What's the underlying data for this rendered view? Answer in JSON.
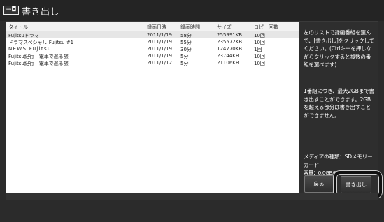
{
  "app": {
    "icon_glyph": "→◘",
    "title": "書き出し"
  },
  "list": {
    "columns": [
      "タイトル",
      "録画日時",
      "録画時間",
      "サイズ",
      "コピー回数"
    ],
    "rows": [
      [
        "Fujitsuドラマ",
        "2011/1/19",
        "58分",
        "255991KB",
        "10回"
      ],
      [
        "ドラマスペシャル Fujitsu #1",
        "2011/1/19",
        "55分",
        "235572KB",
        "10回"
      ],
      [
        "NEWS Fujitsu",
        "2011/1/19",
        "30分",
        "124770KB",
        "1回"
      ],
      [
        "Fujitsu紀行　電車で巡る旅",
        "2011/1/19",
        "5分",
        "23744KB",
        "10回"
      ],
      [
        "Fujitsu紀行　電車で巡る旅",
        "2011/1/12",
        "5分",
        "21106KB",
        "10回"
      ]
    ]
  },
  "sidebar": {
    "help1": "左のリストで録画番組を選んで、[書き出し]をクリックしてください。(Ctrlキーを押しながらクリックすると複数の番組を選べます)",
    "help2": "1番組につき、最大2GBまで書き出すことができます。2GBを超える部分は書き出すことができません。",
    "media_type": "メディアの種類：SDメモリーカード",
    "capacity": "容量：0.0GB/0.1GB"
  },
  "buttons": {
    "back": "戻る",
    "export": "書き出し"
  }
}
